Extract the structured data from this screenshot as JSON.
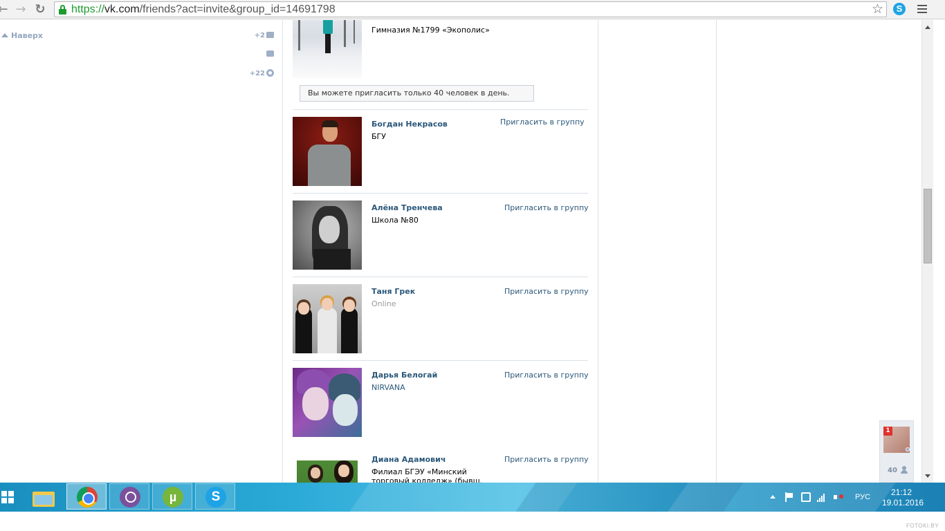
{
  "browser": {
    "url_protocol": "https://",
    "url_host": "vk.com",
    "url_path": "/friends?act=invite&group_id=14691798",
    "back_glyph": "←",
    "forward_glyph": "→",
    "reload_glyph": "↻",
    "star_glyph": "☆",
    "skype_ext_label": "S"
  },
  "sidebar": {
    "up_label": "Наверх",
    "messages_count": "+2",
    "notifications_count": "+22"
  },
  "notice": "Вы можете пригласить только 40 человек в день.",
  "first_entry": {
    "sub": "Гимназия №1799 «Экополис»"
  },
  "friends": [
    {
      "name": "Богдан Некрасов",
      "sub": "БГУ",
      "invite": "Пригласить в группу"
    },
    {
      "name": "Алёна Тренчева",
      "sub": "Школа №80",
      "invite": "Пригласить в группу"
    },
    {
      "name": "Таня Грек",
      "sub": "Online",
      "invite": "Пригласить в группу"
    },
    {
      "name": "Дарья Белогай",
      "sub": "NIRVANA",
      "invite": "Пригласить в группу"
    },
    {
      "name": "Диана Адамович",
      "sub": "Филиал БГЭУ «Минский торговый колледж» (бывш. МГТК)",
      "invite": "Пригласить в группу"
    }
  ],
  "chat": {
    "badge": "1",
    "online_count": "40"
  },
  "taskbar": {
    "utorrent_glyph": "µ",
    "skype_glyph": "S",
    "language": "РУС",
    "time": "21:12",
    "date": "19.01.2016"
  },
  "watermark": "FOTOKI.BY"
}
